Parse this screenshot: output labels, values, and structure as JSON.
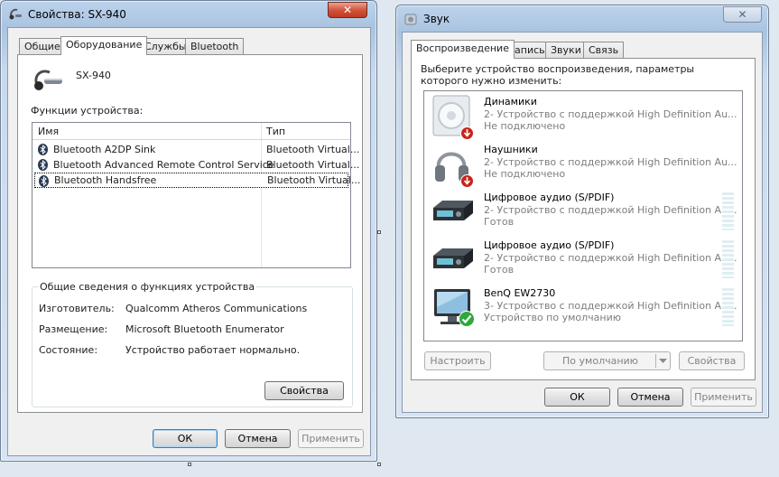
{
  "left_window": {
    "title": "Свойства: SX-940",
    "close_symbol": "✕",
    "tabs": [
      "Общие",
      "Оборудование",
      "Службы",
      "Bluetooth"
    ],
    "active_tab": "Оборудование",
    "device_name": "SX-940",
    "functions_label": "Функции устройства:",
    "list_headers": [
      "Имя",
      "Тип"
    ],
    "list_rows": [
      {
        "name": "Bluetooth A2DP Sink",
        "type": "Bluetooth Virtual..."
      },
      {
        "name": "Bluetooth Advanced Remote Control Service",
        "type": "Bluetooth Virtual..."
      },
      {
        "name": "Bluetooth Handsfree",
        "type": "Bluetooth Virtual..."
      }
    ],
    "selected_row": 2,
    "summary_group_label": "Общие сведения о функциях устройства",
    "summary": [
      {
        "key": "Изготовитель:",
        "value": "Qualcomm Atheros Communications"
      },
      {
        "key": "Размещение:",
        "value": "Microsoft Bluetooth Enumerator"
      },
      {
        "key": "Состояние:",
        "value": "Устройство работает нормально."
      }
    ],
    "properties_button": "Свойства",
    "ok_button": "ОК",
    "cancel_button": "Отмена",
    "apply_button": "Применить"
  },
  "right_window": {
    "title": "Звук",
    "close_symbol": "✕",
    "tabs": [
      "Воспроизведение",
      "Запись",
      "Звуки",
      "Связь"
    ],
    "active_tab": "Воспроизведение",
    "instruction": "Выберите устройство воспроизведения, параметры которого нужно изменить:",
    "devices": [
      {
        "name": "Динамики",
        "line2": "2- Устройство с поддержкой High Definition Au...",
        "status": "Не подключено",
        "icon": "speaker-icon",
        "badge": "disconnected-badge"
      },
      {
        "name": "Наушники",
        "line2": "2- Устройство с поддержкой High Definition Au...",
        "status": "Не подключено",
        "icon": "headphones-icon",
        "badge": "disconnected-badge"
      },
      {
        "name": "Цифровое аудио (S/PDIF)",
        "line2": "2- Устройство с поддержкой High Definition Au...",
        "status": "Готов",
        "icon": "digital-audio-icon",
        "badge": ""
      },
      {
        "name": "Цифровое аудио (S/PDIF)",
        "line2": "2- Устройство с поддержкой High Definition Au...",
        "status": "Готов",
        "icon": "digital-audio-icon",
        "badge": ""
      },
      {
        "name": "BenQ EW2730",
        "line2": "3- Устройство с поддержкой High Definition Au...",
        "status": "Устройство по умолчанию",
        "icon": "monitor-icon",
        "badge": "default-check-badge"
      }
    ],
    "configure_button": "Настроить",
    "default_button": "По умолчанию",
    "properties_button": "Свойства",
    "ok_button": "ОК",
    "cancel_button": "Отмена",
    "apply_button": "Применить"
  },
  "colors": {
    "selection_border": "#000000",
    "disabled_text": "#838383",
    "close_red": "#c0391f",
    "default_check_green": "#2fa83a",
    "disconnected_red": "#c4261d"
  }
}
